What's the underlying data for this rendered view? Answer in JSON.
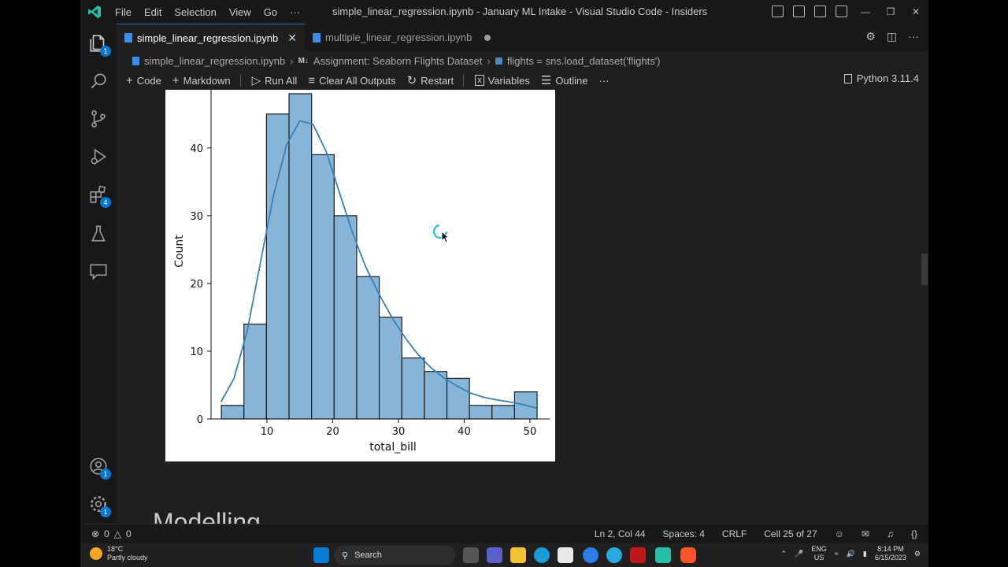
{
  "window": {
    "title": "simple_linear_regression.ipynb - January ML Intake - Visual Studio Code - Insiders",
    "menu": [
      "File",
      "Edit",
      "Selection",
      "View",
      "Go",
      "···"
    ]
  },
  "activity_bar": {
    "explorer_badge": "1",
    "extensions_badge": "4",
    "accounts_badge": "1",
    "settings_badge": "1"
  },
  "tabs": [
    {
      "label": "simple_linear_regression.ipynb",
      "active": true
    },
    {
      "label": "multiple_linear_regression.ipynb",
      "active": false
    }
  ],
  "breadcrumb": {
    "file": "simple_linear_regression.ipynb",
    "section": "Assignment: Seaborn Flights Dataset",
    "section_prefix": "M↓",
    "cell": "flights = sns.load_dataset('flights')"
  },
  "toolbar": {
    "code": "Code",
    "markdown": "Markdown",
    "run_all": "Run All",
    "clear_outputs": "Clear All Outputs",
    "restart": "Restart",
    "variables": "Variables",
    "outline": "Outline",
    "more": "···",
    "kernel": "Python 3.11.4"
  },
  "chart_data": {
    "type": "bar",
    "xlabel": "total_bill",
    "ylabel": "Count",
    "xlim": [
      1.5,
      53
    ],
    "ylim": [
      0,
      48
    ],
    "x_ticks": [
      10,
      20,
      30,
      40,
      50
    ],
    "y_ticks": [
      0,
      10,
      20,
      30,
      40
    ],
    "bin_edges": [
      3.07,
      6.5,
      9.93,
      13.36,
      16.79,
      20.22,
      23.65,
      27.08,
      30.51,
      33.94,
      37.37,
      40.8,
      44.23,
      47.66,
      51.09
    ],
    "values": [
      2,
      14,
      45,
      48,
      39,
      30,
      21,
      15,
      9,
      7,
      6,
      2,
      2,
      4
    ],
    "kde": {
      "x": [
        3,
        5,
        7,
        9,
        11,
        13,
        15,
        17,
        19,
        21,
        23,
        25,
        27,
        29,
        31,
        33,
        35,
        37,
        39,
        41,
        43,
        45,
        47,
        49,
        51
      ],
      "y": [
        2.5,
        6,
        13,
        23,
        33,
        40.5,
        44,
        43.5,
        39.5,
        33.5,
        27.5,
        22.5,
        18.5,
        15,
        12,
        9.5,
        7.5,
        6,
        4.8,
        3.8,
        3.2,
        2.8,
        2.5,
        2.1,
        1.6
      ]
    },
    "bar_color": "#87b5d8",
    "line_color": "#3a7fb5"
  },
  "next_cell_heading": "Modelling",
  "status_bar": {
    "errors": "0",
    "warnings": "0",
    "position": "Ln 2, Col 44",
    "spaces": "Spaces: 4",
    "eol": "CRLF",
    "cell": "Cell 25 of 27"
  },
  "taskbar": {
    "weather_temp": "18°C",
    "weather_desc": "Partly cloudy",
    "search": "Search",
    "lang": "ENG",
    "region": "US",
    "time": "8:14 PM",
    "date": "6/15/2023"
  }
}
